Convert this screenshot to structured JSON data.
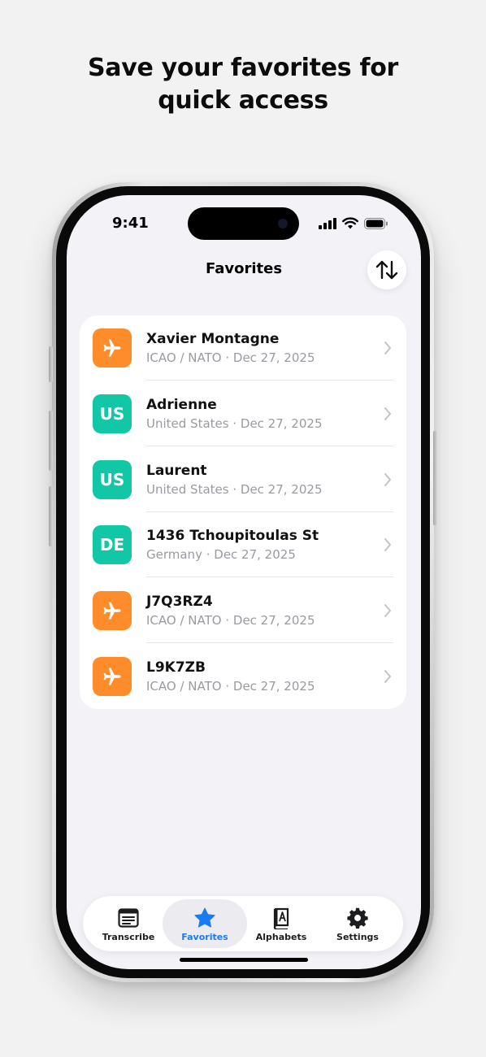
{
  "headline": {
    "line1": "Save your favorites for",
    "line2": "quick access"
  },
  "status_bar": {
    "time": "9:41",
    "icons": [
      "signal-icon",
      "wifi-icon",
      "battery-icon"
    ]
  },
  "nav": {
    "title": "Favorites",
    "sort_icon": "sort-arrows-icon"
  },
  "favorites": [
    {
      "title": "Xavier Montagne",
      "alphabet": "ICAO / NATO",
      "date": "Dec 27, 2025",
      "icon": "airplane-icon",
      "badge": "",
      "color": "#ff8c2a"
    },
    {
      "title": "Adrienne",
      "alphabet": "United States",
      "date": "Dec 27, 2025",
      "icon": "",
      "badge": "US",
      "color": "#12c7a6"
    },
    {
      "title": "Laurent",
      "alphabet": "United States",
      "date": "Dec 27, 2025",
      "icon": "",
      "badge": "US",
      "color": "#12c7a6"
    },
    {
      "title": "1436 Tchoupitoulas St",
      "alphabet": "Germany",
      "date": "Dec 27, 2025",
      "icon": "",
      "badge": "DE",
      "color": "#12c7a6"
    },
    {
      "title": "J7Q3RZ4",
      "alphabet": "ICAO / NATO",
      "date": "Dec 27, 2025",
      "icon": "airplane-icon",
      "badge": "",
      "color": "#ff8c2a"
    },
    {
      "title": "L9K7ZB",
      "alphabet": "ICAO / NATO",
      "date": "Dec 27, 2025",
      "icon": "airplane-icon",
      "badge": "",
      "color": "#ff8c2a"
    }
  ],
  "subtitle_separator": " · ",
  "tabbar": {
    "tabs": [
      {
        "label": "Transcribe",
        "icon": "transcribe-icon",
        "active": false
      },
      {
        "label": "Favorites",
        "icon": "star-icon",
        "active": true
      },
      {
        "label": "Alphabets",
        "icon": "alphabet-book-icon",
        "active": false
      },
      {
        "label": "Settings",
        "icon": "gear-icon",
        "active": false
      }
    ]
  },
  "colors": {
    "accent": "#1a7cf5",
    "orange": "#ff8c2a",
    "teal": "#12c7a6",
    "background": "#f2f2f7"
  }
}
